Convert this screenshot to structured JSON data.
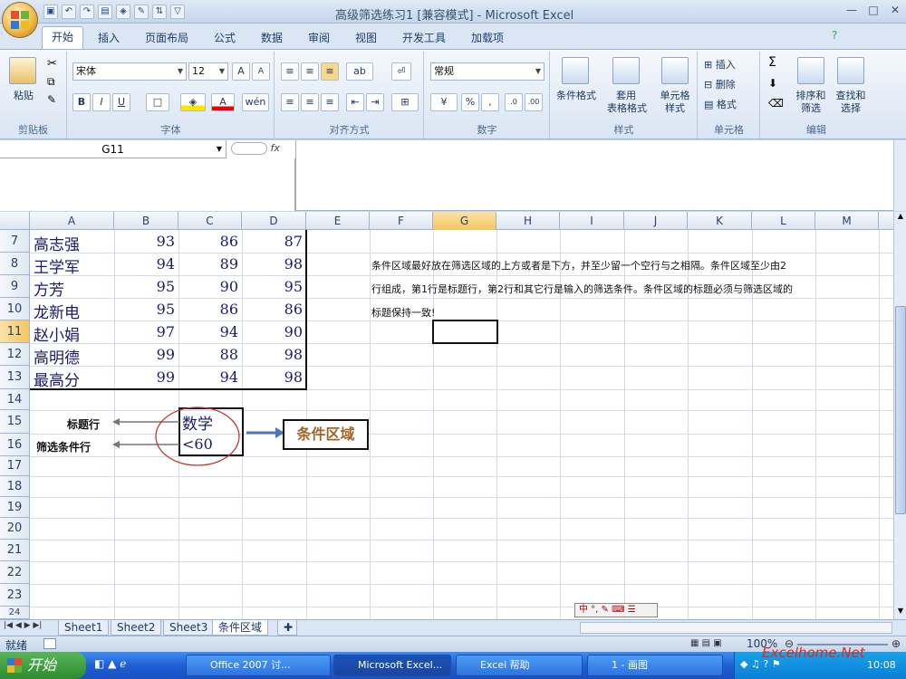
{
  "window": {
    "title": "高级筛选练习1  [兼容模式] - Microsoft Excel"
  },
  "ribbon": {
    "tabs": [
      "开始",
      "插入",
      "页面布局",
      "公式",
      "数据",
      "审阅",
      "视图",
      "开发工具",
      "加载项"
    ],
    "clipboard": {
      "paste": "粘贴",
      "label": "剪贴板"
    },
    "font": {
      "name": "宋体",
      "size": "12",
      "label": "字体"
    },
    "alignment": {
      "label": "对齐方式"
    },
    "number": {
      "format": "常规",
      "label": "数字"
    },
    "styles": {
      "cond": "条件格式",
      "table1": "套用",
      "table2": "表格格式",
      "cell1": "单元格",
      "cell2": "样式",
      "label": "样式"
    },
    "cells": {
      "insert": "插入",
      "delete": "删除",
      "format": "格式",
      "label": "单元格"
    },
    "editing": {
      "sort1": "排序和",
      "sort2": "筛选",
      "find1": "查找和",
      "find2": "选择",
      "label": "编辑"
    }
  },
  "formula_bar": {
    "cell_ref": "G11",
    "fx": "fx",
    "value": ""
  },
  "columns": [
    "A",
    "B",
    "C",
    "D",
    "E",
    "F",
    "G",
    "H",
    "I",
    "J",
    "K",
    "L",
    "M"
  ],
  "selected_column": "G",
  "rows": [
    "7",
    "8",
    "9",
    "10",
    "11",
    "12",
    "13",
    "14",
    "15",
    "16",
    "17",
    "18",
    "19",
    "20",
    "21",
    "22",
    "23",
    "24"
  ],
  "selected_row": "11",
  "table": [
    {
      "name": "高志强",
      "b": "93",
      "c": "86",
      "d": "87"
    },
    {
      "name": "王学军",
      "b": "94",
      "c": "89",
      "d": "98"
    },
    {
      "name": "方芳",
      "b": "95",
      "c": "90",
      "d": "95"
    },
    {
      "name": "龙新电",
      "b": "95",
      "c": "86",
      "d": "86"
    },
    {
      "name": "赵小娟",
      "b": "97",
      "c": "94",
      "d": "90"
    },
    {
      "name": "高明德",
      "b": "99",
      "c": "88",
      "d": "98"
    },
    {
      "name": "最高分",
      "b": "99",
      "c": "94",
      "d": "98"
    }
  ],
  "criteria": {
    "header": "数学",
    "condition": "<60",
    "label_header_row": "标题行",
    "label_criteria_row": "筛选条件行",
    "area_label": "条件区域"
  },
  "note": {
    "line1": "条件区域最好放在筛选区域的上方或者是下方，并至少留一个空行与之相隔。条件区域至少由2",
    "line2": "行组成，第1行是标题行，第2行和其它行是输入的筛选条件。条件区域的标题必须与筛选区域的",
    "line3": "标题保持一致!"
  },
  "sheet_tabs": [
    "Sheet1",
    "Sheet2",
    "Sheet3",
    "条件区域"
  ],
  "active_sheet": "条件区域",
  "status": {
    "ready": "就绪",
    "zoom": "100%"
  },
  "taskbar": {
    "start": "开始",
    "items": [
      "Office 2007 讨...",
      "Microsoft Excel...",
      "Excel 帮助",
      "1 - 画图"
    ],
    "watermark": "Excelhome.Net",
    "clock": "10:08"
  }
}
